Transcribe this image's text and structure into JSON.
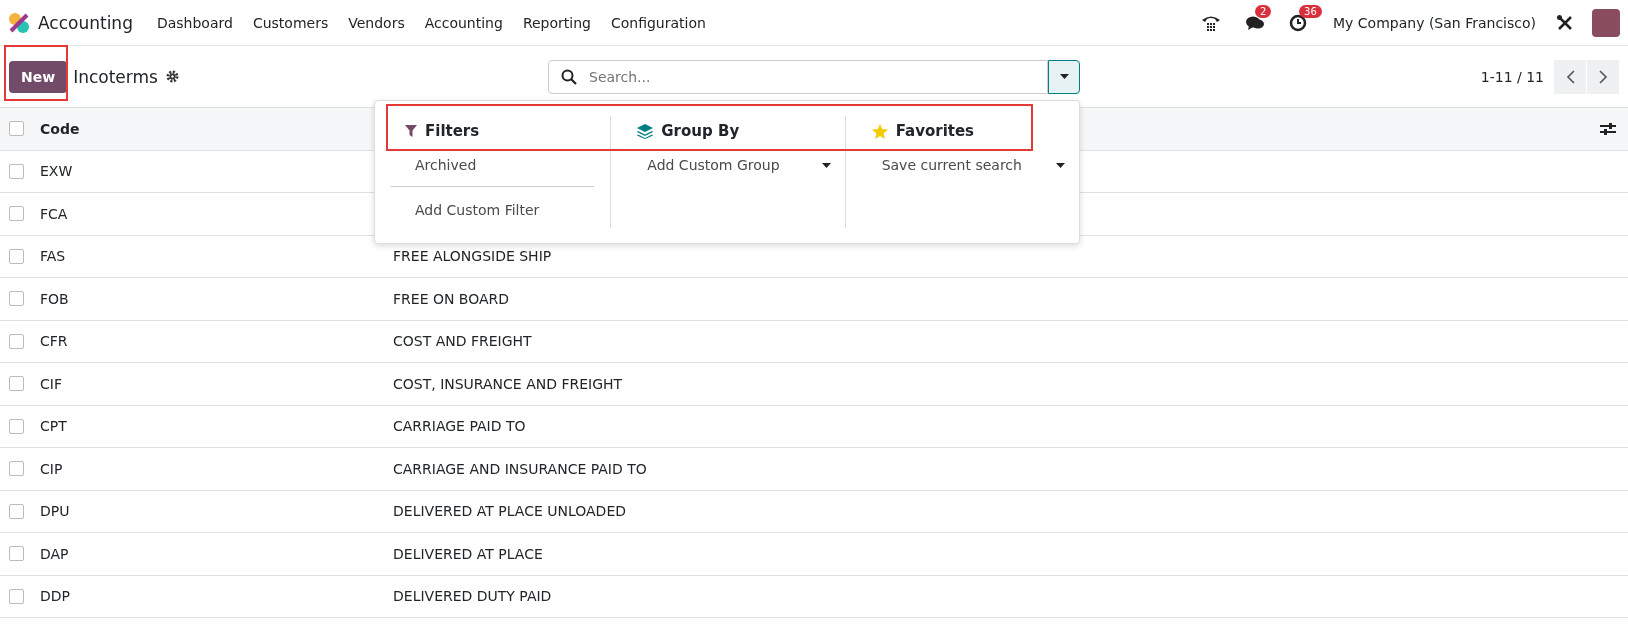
{
  "navbar": {
    "app_name": "Accounting",
    "menu": [
      "Dashboard",
      "Customers",
      "Vendors",
      "Accounting",
      "Reporting",
      "Configuration"
    ],
    "messages_badge": "2",
    "activities_badge": "36",
    "company": "My Company (San Francisco)"
  },
  "control_panel": {
    "new_button": "New",
    "title": "Incoterms",
    "search": {
      "placeholder": "Search..."
    },
    "pager": "1-11 / 11"
  },
  "table": {
    "columns": [
      "Code"
    ],
    "select_all_checked": false,
    "rows": [
      {
        "code": "EXW",
        "checked": false
      },
      {
        "code": "FCA",
        "checked": false
      },
      {
        "code": "FAS",
        "description": "FREE ALONGSIDE SHIP",
        "checked": false
      },
      {
        "code": "FOB",
        "description": "FREE ON BOARD",
        "checked": false
      },
      {
        "code": "CFR",
        "description": "COST AND FREIGHT",
        "checked": false
      },
      {
        "code": "CIF",
        "description": "COST, INSURANCE AND FREIGHT",
        "checked": false
      },
      {
        "code": "CPT",
        "description": "CARRIAGE PAID TO",
        "checked": false
      },
      {
        "code": "CIP",
        "description": "CARRIAGE AND INSURANCE PAID TO",
        "checked": false
      },
      {
        "code": "DPU",
        "description": "DELIVERED AT PLACE UNLOADED",
        "checked": false
      },
      {
        "code": "DAP",
        "description": "DELIVERED AT PLACE",
        "checked": false
      },
      {
        "code": "DDP",
        "description": "DELIVERED DUTY PAID",
        "checked": false
      }
    ]
  },
  "search_panel": {
    "sections": [
      {
        "kind": "filters",
        "title": "Filters",
        "items": [
          "Archived"
        ],
        "custom": "Add Custom Filter"
      },
      {
        "kind": "groupby",
        "title": "Group By",
        "custom": "Add Custom Group"
      },
      {
        "kind": "favorites",
        "title": "Favorites",
        "custom": "Save current search"
      }
    ]
  }
}
